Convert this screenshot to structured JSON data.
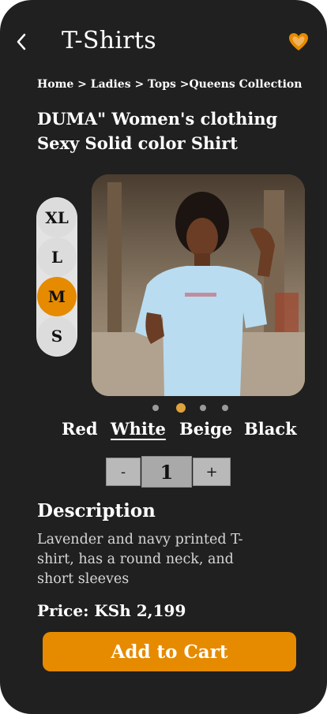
{
  "header": {
    "title": "T-Shirts",
    "back_icon": "chevron-left-icon",
    "favorite_icon": "heart-icon",
    "favorite_color": "#e68a00"
  },
  "breadcrumb": "Home > Ladies > Tops >Queens Collection",
  "product": {
    "name": "DUMA\" Women's clothing Sexy Solid color Shirt"
  },
  "sizes": [
    {
      "label": "XL",
      "selected": false
    },
    {
      "label": "L",
      "selected": false
    },
    {
      "label": "M",
      "selected": true
    },
    {
      "label": "S",
      "selected": false
    }
  ],
  "gallery": {
    "image": "woman-in-light-blue-tshirt-photo",
    "dot_count": 4,
    "active_dot_index": 1
  },
  "colors": [
    {
      "label": "Red",
      "selected": false
    },
    {
      "label": "White",
      "selected": true
    },
    {
      "label": "Beige",
      "selected": false
    },
    {
      "label": "Black",
      "selected": false
    }
  ],
  "quantity": {
    "decrement_label": "-",
    "value": "1",
    "increment_label": "+"
  },
  "description": {
    "heading": "Description",
    "text": "Lavender and navy printed T-shirt, has a round neck, and short sleeves"
  },
  "price": "Price: KSh 2,199",
  "add_to_cart_label": "Add to Cart",
  "theme": {
    "background": "#202020",
    "accent": "#e68a00"
  }
}
